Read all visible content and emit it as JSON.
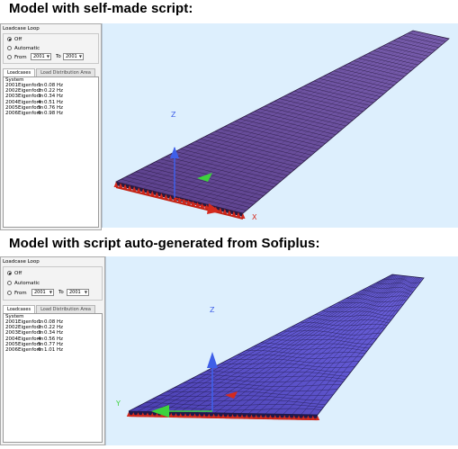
{
  "headings": {
    "top": "Model with self-made script:",
    "bottom": "Model with script auto-generated from Sofiplus:"
  },
  "panels": [
    {
      "loadcase_loop_title": "Loadcase Loop",
      "options": {
        "off": "Off",
        "automatic": "Automatic",
        "from": "From",
        "to": "To"
      },
      "selected_option": "off",
      "from_value": "2001",
      "to_value": "2001",
      "tabs": [
        "Loadcases",
        "Load Distribution Area"
      ],
      "active_tab": "Loadcases",
      "list_header": "System",
      "rows": [
        {
          "id": "2001",
          "name": "Eigenform",
          "num": "1",
          "freq": "0.08 Hz"
        },
        {
          "id": "2002",
          "name": "Eigenform",
          "num": "2",
          "freq": "0.22 Hz"
        },
        {
          "id": "2003",
          "name": "Eigenform",
          "num": "3",
          "freq": "0.34 Hz"
        },
        {
          "id": "2004",
          "name": "Eigenform",
          "num": "4",
          "freq": "0.51 Hz"
        },
        {
          "id": "2005",
          "name": "Eigenform",
          "num": "5",
          "freq": "0.76 Hz"
        },
        {
          "id": "2006",
          "name": "Eigenform",
          "num": "6",
          "freq": "0.98 Hz"
        }
      ]
    },
    {
      "loadcase_loop_title": "Loadcase Loop",
      "options": {
        "off": "Off",
        "automatic": "Automatic",
        "from": "From",
        "to": "To"
      },
      "selected_option": "off",
      "from_value": "2001",
      "to_value": "2001",
      "tabs": [
        "Loadcases",
        "Load Distribution Area"
      ],
      "active_tab": "Loadcases",
      "list_header": "System",
      "rows": [
        {
          "id": "2001",
          "name": "Eigenform",
          "num": "1",
          "freq": "0.08 Hz"
        },
        {
          "id": "2002",
          "name": "Eigenform",
          "num": "2",
          "freq": "0.22 Hz"
        },
        {
          "id": "2003",
          "name": "Eigenform",
          "num": "3",
          "freq": "0.34 Hz"
        },
        {
          "id": "2004",
          "name": "Eigenform",
          "num": "4",
          "freq": "0.56 Hz"
        },
        {
          "id": "2005",
          "name": "Eigenform",
          "num": "5",
          "freq": "0.77 Hz"
        },
        {
          "id": "2006",
          "name": "Eigenform",
          "num": "6",
          "freq": "1.01 Hz"
        }
      ]
    }
  ],
  "viewports": [
    {
      "axis_labels": {
        "z": "Z",
        "x": "X"
      },
      "mesh": "regular"
    },
    {
      "axis_labels": {
        "z": "Z",
        "y": "Y"
      },
      "mesh": "irregular"
    }
  ],
  "colors": {
    "viewport_bg": "#ddeffd",
    "mesh_fill": "#6a4f9e",
    "mesh_fill_2": "#5a52c8",
    "support_red": "#d42a1e",
    "axis_blue": "#3f5fe8",
    "axis_green": "#3dd23d"
  }
}
